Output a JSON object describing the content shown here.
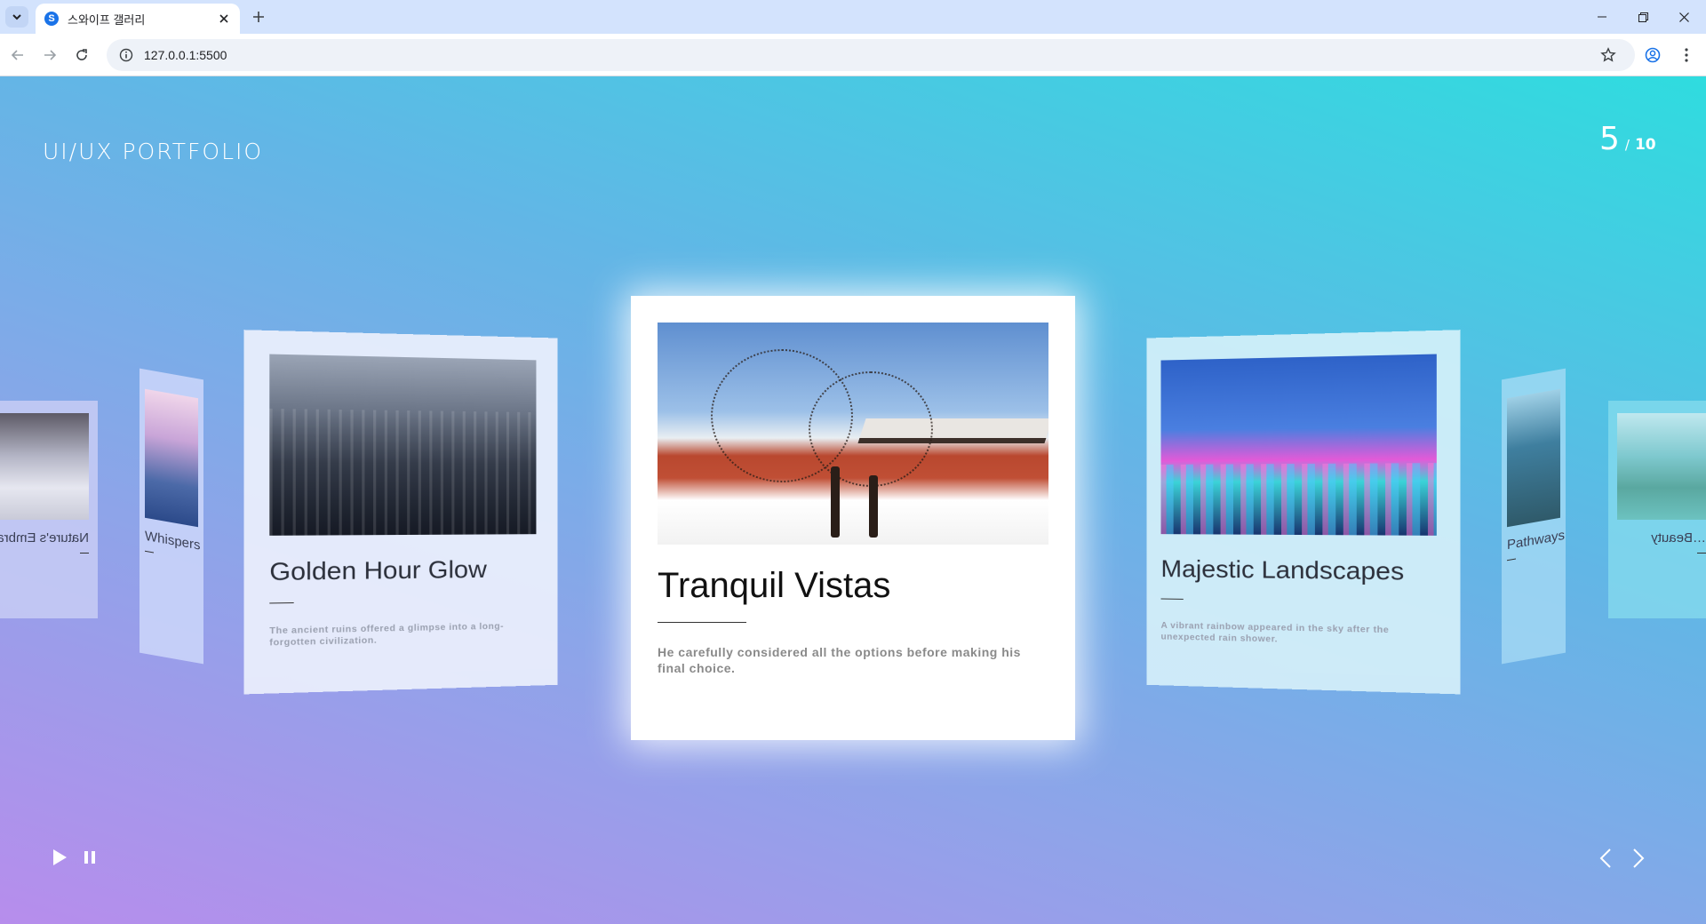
{
  "browser": {
    "tab": {
      "title": "스와이프 갤러리",
      "favicon": "S"
    },
    "url": "127.0.0.1:5500",
    "icons": {
      "tab_search": "chevron-down-icon",
      "close_tab": "close-icon",
      "new_tab": "plus-icon",
      "back": "arrow-left-icon",
      "forward": "arrow-right-icon",
      "reload": "reload-icon",
      "site_info": "info-icon",
      "bookmark": "star-icon",
      "profile": "profile-icon",
      "menu": "kebab-menu-icon",
      "minimize": "minimize-icon",
      "restore": "restore-icon",
      "close_window": "close-icon"
    }
  },
  "gallery": {
    "brand": "UI/UX PORTFOLIO",
    "counter": {
      "current": "5",
      "separator": "/",
      "total": "10"
    },
    "cards": {
      "center": {
        "title": "Tranquil Vistas",
        "description": "He carefully considered all the options before making his final choice."
      },
      "left1": {
        "title": "Golden Hour Glow",
        "description": "The ancient ruins offered a glimpse into a long-forgotten civilization."
      },
      "right1": {
        "title": "Majestic Landscapes",
        "description": "A vibrant rainbow appeared in the sky after the unexpected rain shower."
      },
      "left2": {
        "title": "Whispers of the W…",
        "description": ""
      },
      "right2": {
        "title": "Pathways to Peace",
        "description": ""
      },
      "left3": {
        "title": "Nature's Embra…",
        "description": ""
      },
      "right3": {
        "title": "…Beauty",
        "description": ""
      }
    },
    "controls": {
      "play": "play-icon",
      "pause": "pause-icon",
      "prev": "chevron-left-icon",
      "next": "chevron-right-icon"
    }
  },
  "colors": {
    "gradient_start": "#b78dec",
    "gradient_end": "#2fdcdf",
    "card_bg": "#ffffff"
  }
}
